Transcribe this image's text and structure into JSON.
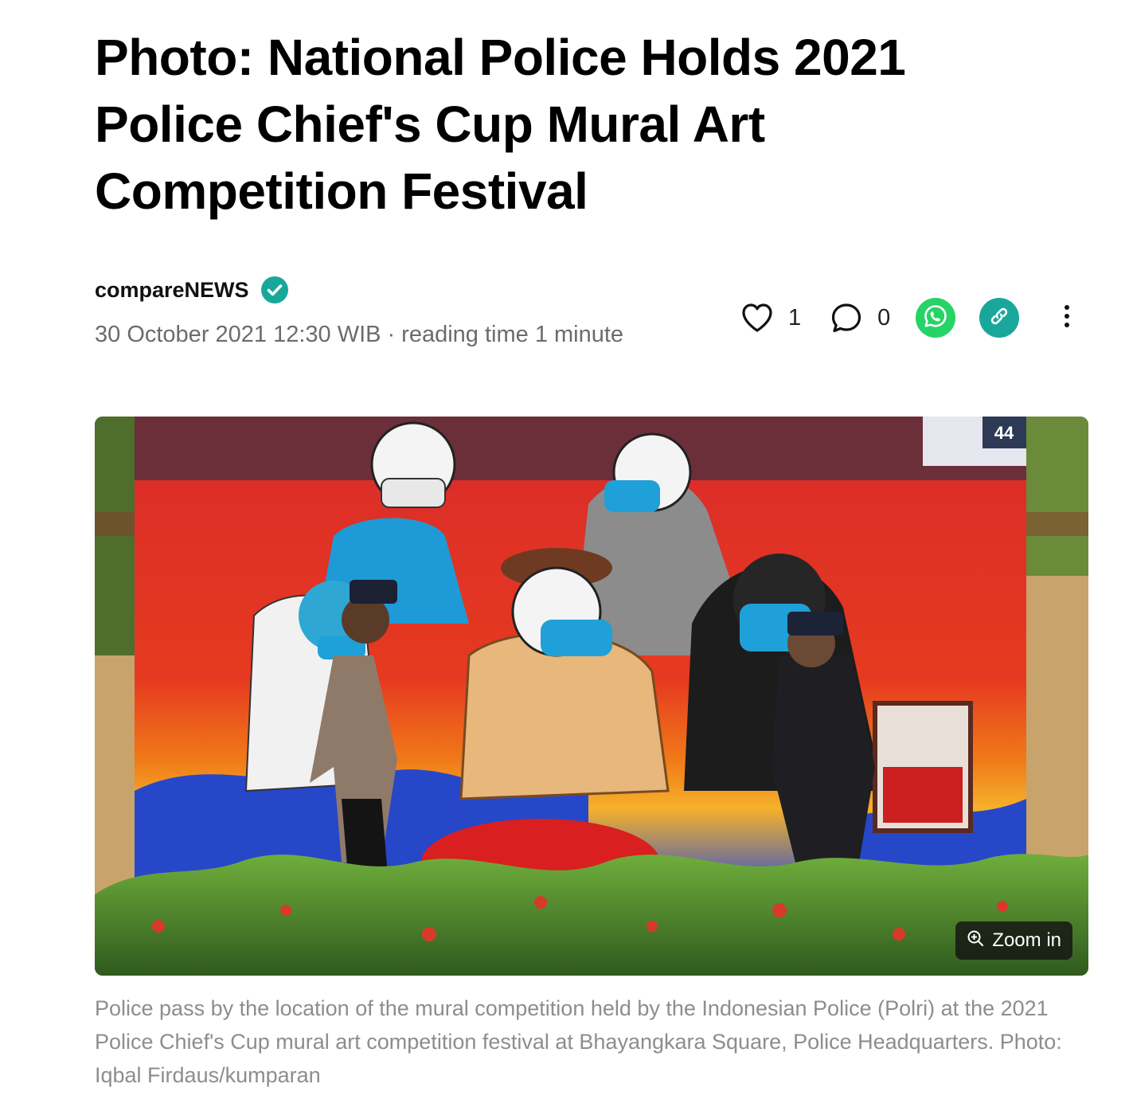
{
  "article": {
    "title": "Photo: National Police Holds 2021 Police Chief's Cup Mural Art Competition Festival",
    "author": "compareNEWS",
    "date": "30 October 2021 12:30 WIB",
    "separator": "·",
    "reading_time": "reading time 1 minute"
  },
  "actions": {
    "likes": "1",
    "comments": "0"
  },
  "photo": {
    "zoom_label": "Zoom in",
    "caption": "Police pass by the location of the mural competition held by the Indonesian Police (Polri) at the 2021 Police Chief's Cup mural art competition festival at Bhayangkara Square, Police Headquarters. Photo: Iqbal Firdaus/kumparan",
    "mural_badge": "44"
  },
  "colors": {
    "verified": "#1aa79b",
    "whatsapp": "#25d366",
    "link": "#1aa79b",
    "meta_text": "#6b6b6b",
    "caption_text": "#8d8d8d"
  },
  "icons": {
    "verified": "verified-check-icon",
    "like": "heart-outline-icon",
    "comment": "speech-bubble-icon",
    "whatsapp": "whatsapp-icon",
    "link": "link-icon",
    "more": "vertical-dots-icon",
    "zoom": "zoom-in-icon"
  }
}
